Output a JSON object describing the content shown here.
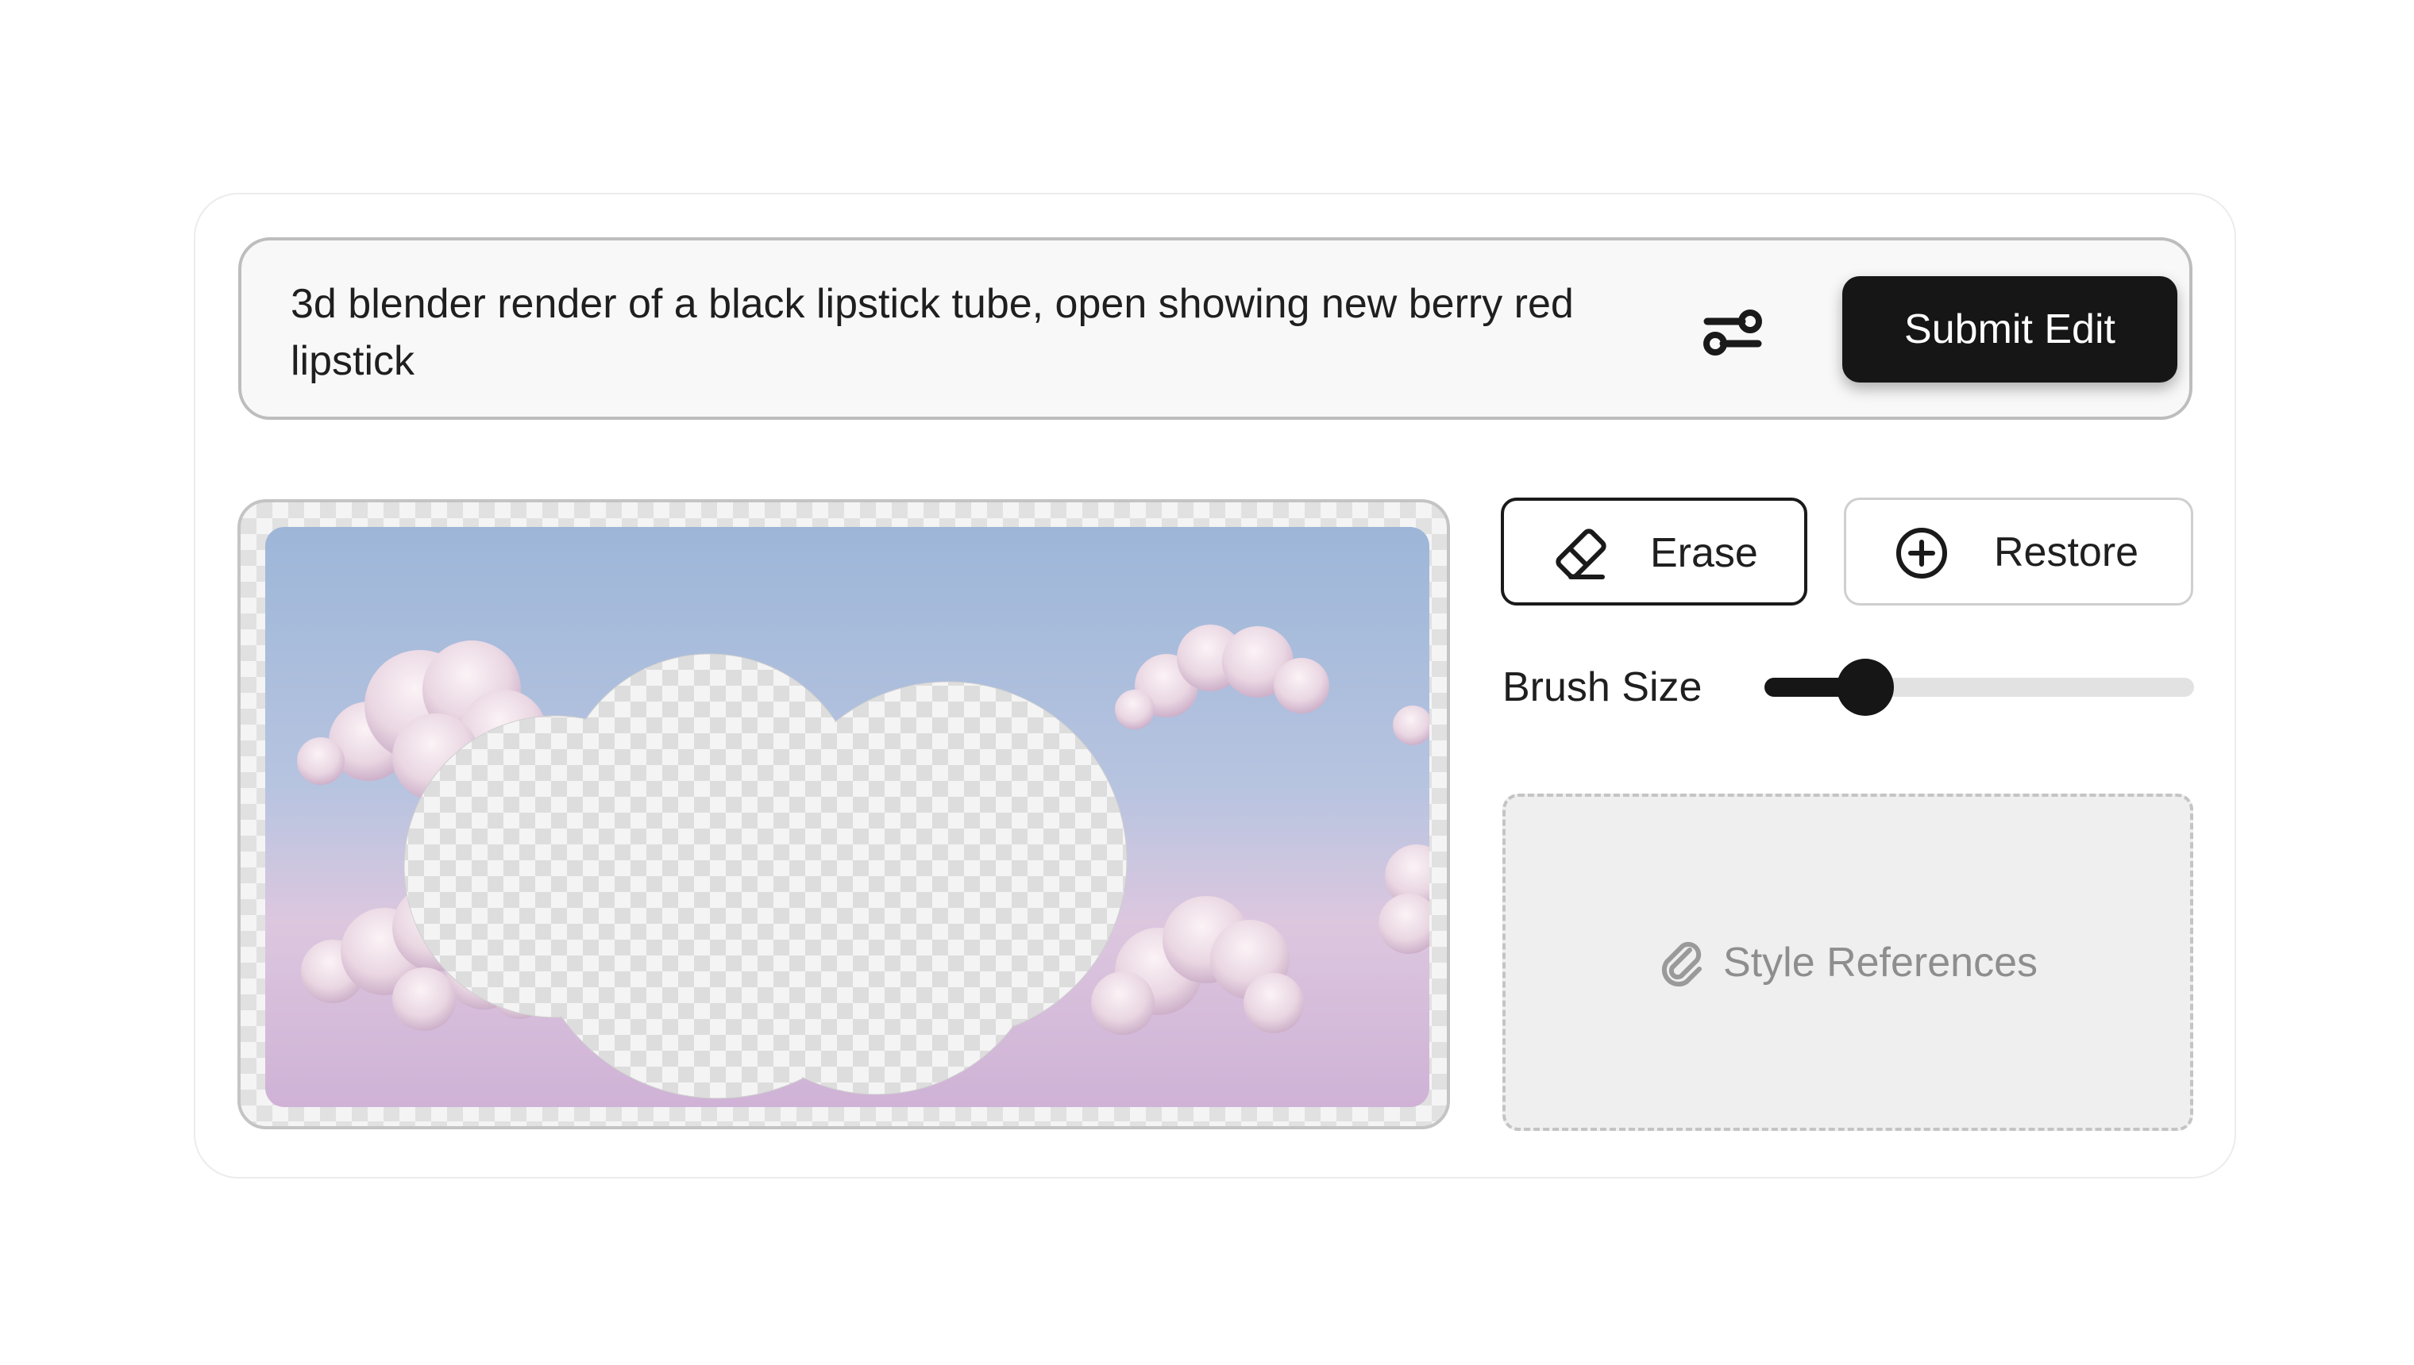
{
  "prompt": {
    "text": "3d blender render of a black lipstick tube, open showing new berry red lipstick",
    "settings_icon": "sliders-icon",
    "submit_label": "Submit Edit"
  },
  "canvas": {
    "image_description_icon": "canvas-image",
    "mask_shape": "cloud-erased-region"
  },
  "tools": {
    "erase_label": "Erase",
    "erase_icon": "eraser-icon",
    "restore_label": "Restore",
    "restore_icon": "plus-circle-icon",
    "active_tool": "erase"
  },
  "brush": {
    "label": "Brush Size",
    "value_fraction": 0.235
  },
  "style_references": {
    "label": "Style References",
    "icon": "paperclip-icon"
  },
  "colors": {
    "accent": "#161616",
    "sky_top": "#9fb8d9",
    "sky_bottom": "#d7bcdb",
    "checker_light": "#f4f4f4",
    "checker_dark": "#e1e1e1"
  }
}
